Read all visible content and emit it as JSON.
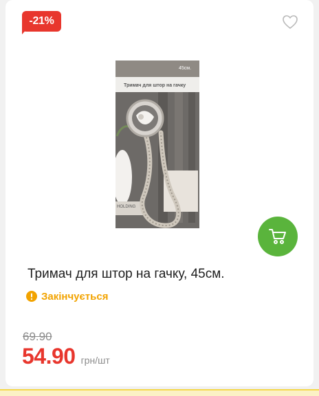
{
  "product": {
    "discount_badge": "-21%",
    "title": "Тримач для штор на гачку, 45см.",
    "stock_status": "Закінчується",
    "old_price": "69.90",
    "price": "54.90",
    "unit": "грн/шт",
    "package_text": {
      "size": "45см.",
      "name": "Тримач для штор на гачку",
      "bottom": "HOLDING"
    }
  },
  "icons": {
    "favorite": "heart-outline-icon",
    "cart": "shopping-cart-icon",
    "warning": "exclamation-circle-icon"
  },
  "colors": {
    "accent_red": "#e8362d",
    "cart_green": "#5ab43c",
    "warning_orange": "#f2a300",
    "muted_gray": "#8b8b8b"
  }
}
